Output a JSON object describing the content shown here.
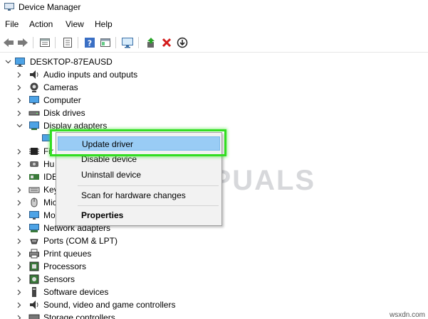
{
  "window": {
    "title": "Device Manager"
  },
  "menu": [
    "File",
    "Action",
    "View",
    "Help"
  ],
  "toolbar": {
    "icons": [
      "back-icon",
      "forward-icon",
      "properties-icon",
      "show-hide-icon",
      "help-icon",
      "console-icon",
      "monitor-icon",
      "update-driver-icon",
      "uninstall-icon",
      "download-icon"
    ]
  },
  "tree": {
    "root": "DESKTOP-87EAUSD",
    "categories": [
      "Audio inputs and outputs",
      "Cameras",
      "Computer",
      "Disk drives",
      "Display adapters",
      "",
      "Fir",
      "Hu",
      "IDE",
      "Key",
      "Mic",
      "Mo",
      "Network adapters",
      "Ports (COM & LPT)",
      "Print queues",
      "Processors",
      "Sensors",
      "Software devices",
      "Sound, video and game controllers",
      "Storage controllers"
    ]
  },
  "context_menu": {
    "items": [
      "Update driver",
      "Disable device",
      "Uninstall device",
      "Scan for hardware changes",
      "Properties"
    ],
    "highlighted": "Update driver"
  },
  "watermark": "A  PUALS",
  "footer": "wsxdn.com"
}
